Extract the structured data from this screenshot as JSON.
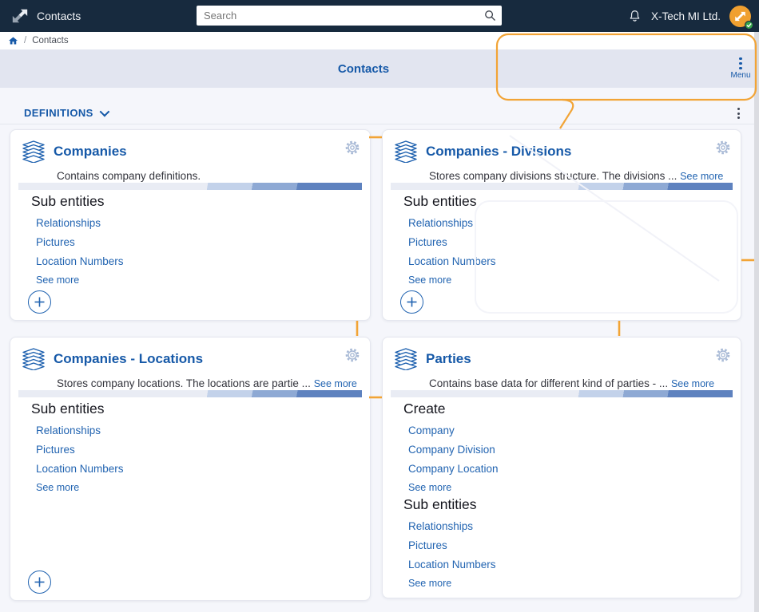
{
  "topbar": {
    "app_title": "Contacts",
    "search": {
      "placeholder": "Search"
    },
    "org_name": "X-Tech MI Ltd."
  },
  "breadcrumb": {
    "separator": "/",
    "current": "Contacts"
  },
  "page_header": {
    "title": "Contacts",
    "menu_label": "Menu"
  },
  "definitions_bar": {
    "title": "DEFINITIONS"
  },
  "cards": [
    {
      "title": "Companies",
      "description": "Contains company definitions.",
      "sections": [
        {
          "heading": "Sub entities",
          "links": [
            "Relationships",
            "Pictures",
            "Location Numbers"
          ],
          "see_more": "See more"
        }
      ]
    },
    {
      "title": "Companies - Divisions",
      "description": "Stores company divisions structure. The divisions ...",
      "see_more": "See more",
      "sections": [
        {
          "heading": "Sub entities",
          "links": [
            "Relationships",
            "Pictures",
            "Location Numbers"
          ],
          "see_more": "See more"
        }
      ]
    },
    {
      "title": "Companies - Locations",
      "description": "Stores company locations. The locations are partie ...",
      "see_more": "See more",
      "sections": [
        {
          "heading": "Sub entities",
          "links": [
            "Relationships",
            "Pictures",
            "Location Numbers"
          ],
          "see_more": "See more"
        }
      ]
    },
    {
      "title": "Parties",
      "description": "Contains base data for different kind of parties - ...",
      "see_more": "See more",
      "sections": [
        {
          "heading": "Create",
          "links": [
            "Company",
            "Company Division",
            "Company Location"
          ],
          "see_more": "See more"
        },
        {
          "heading": "Sub entities",
          "links": [
            "Relationships",
            "Pictures",
            "Location Numbers"
          ],
          "see_more": "See more"
        }
      ]
    }
  ],
  "colors": {
    "topbar_navy": "#172A3E",
    "brand_blue": "#1659A8",
    "link_blue": "#2264B1",
    "accent_orange": "#F2A436",
    "band_gray_blue": "#E2E5F0",
    "avatar_orange": "#F0A030",
    "status_green": "#35A24A"
  },
  "icons": {
    "app_logo": "diagonal-arrows-logo",
    "search": "magnifier",
    "notifications": "bell",
    "user_avatar": "orange-arrows-avatar",
    "avatar_status": "check-badge",
    "breadcrumb_home": "home",
    "header_menu": "kebab-dots",
    "section_collapse": "chevron-down",
    "entity_card": "layer-stack",
    "card_settings": "gear",
    "add_entity": "plus-circle"
  }
}
